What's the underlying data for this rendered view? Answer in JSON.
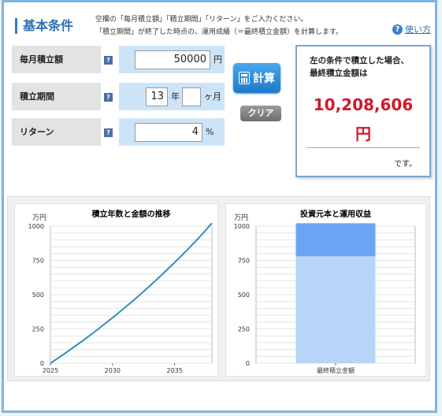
{
  "header": {
    "title": "基本条件",
    "desc_line1": "空欄の「毎月積立額」「積立期間」「リターン」をご入力ください。",
    "desc_line2": "「積立期間」が終了した時点の、運用成績（＝最終積立金額）を計算します。",
    "help_label": "使い方"
  },
  "form": {
    "monthly": {
      "label": "毎月積立額",
      "value": "50000",
      "unit": "円"
    },
    "period": {
      "label": "積立期間",
      "years": "13",
      "years_unit": "年",
      "months": "",
      "months_unit": "ヶ月"
    },
    "return": {
      "label": "リターン",
      "value": "4",
      "unit": "%"
    },
    "help_icon": "?"
  },
  "buttons": {
    "calc_label": "計算",
    "clear_label": "クリア"
  },
  "result": {
    "line1": "左の条件で積立した場合、",
    "line2": "最終積立金額は",
    "amount": "10,208,606",
    "yen": "円",
    "desu": "です。"
  },
  "chart_data": [
    {
      "type": "line",
      "title": "積立年数と金額の推移",
      "ylabel": "万円",
      "xlabel": "",
      "ylim": [
        0,
        1000
      ],
      "xlim": [
        2025,
        2038
      ],
      "yticks": [
        0,
        250,
        500,
        750,
        1000
      ],
      "xticks": [
        2025,
        2030,
        2035
      ],
      "grid": true,
      "colors": {
        "line": "#2f90b8"
      },
      "series": [
        {
          "x": [
            2025,
            2026,
            2027,
            2028,
            2029,
            2030,
            2031,
            2032,
            2033,
            2034,
            2035,
            2036,
            2037,
            2038
          ],
          "y": [
            0,
            61,
            125,
            191,
            260,
            332,
            406,
            483,
            564,
            648,
            735,
            825,
            920,
            1021
          ]
        }
      ]
    },
    {
      "type": "bar",
      "title": "投資元本と運用収益",
      "ylabel": "万円",
      "ylim": [
        0,
        1000
      ],
      "yticks": [
        0,
        250,
        500,
        750,
        1000
      ],
      "categories": [
        "最終積立金額"
      ],
      "grid": true,
      "series": [
        {
          "values": [
            780
          ],
          "color": "#b7d6f7"
        },
        {
          "values": [
            241
          ],
          "color": "#6aa5f3"
        }
      ]
    }
  ]
}
